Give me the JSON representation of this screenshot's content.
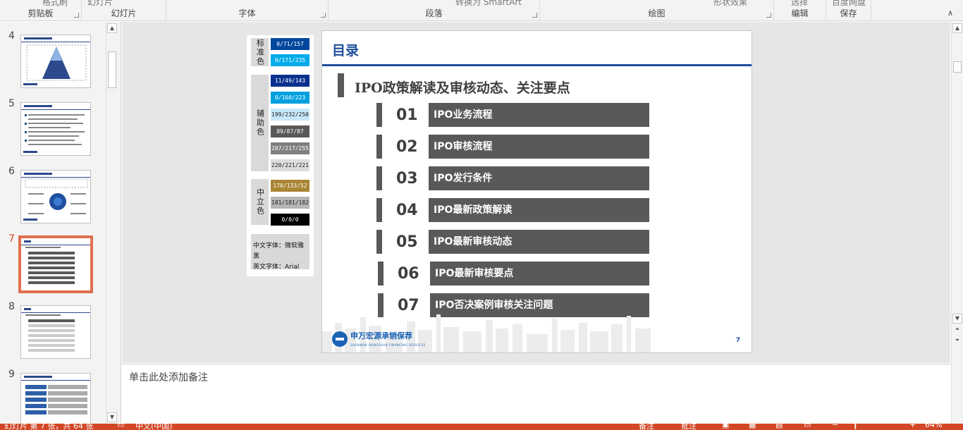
{
  "ribbon": {
    "groups": [
      {
        "label": "剪贴板",
        "top": "格式刷"
      },
      {
        "label": "幻灯片",
        "top": "幻灯片"
      },
      {
        "label": "字体",
        "top": ""
      },
      {
        "label": "段落",
        "top": "转换为 SmartArt"
      },
      {
        "label": "绘图",
        "top": "形状效果"
      },
      {
        "label": "编辑",
        "top": "选择"
      },
      {
        "label": "保存",
        "top": "百度网盘"
      }
    ],
    "collapse_icon": "chevron-up-icon"
  },
  "thumbnails": [
    {
      "number": "4"
    },
    {
      "number": "5"
    },
    {
      "number": "6"
    },
    {
      "number": "7"
    },
    {
      "number": "8"
    },
    {
      "number": "9"
    }
  ],
  "legend": {
    "groups": [
      {
        "label": "标准色",
        "swatches": [
          {
            "text": "0/71/157",
            "bg": "#00479D",
            "fg": "#ffffff"
          },
          {
            "text": "0/171/235",
            "bg": "#00ABEB",
            "fg": "#ffffff"
          }
        ]
      },
      {
        "label": "辅助色",
        "swatches": [
          {
            "text": "11/49/143",
            "bg": "#0B318F",
            "fg": "#ffffff"
          },
          {
            "text": "0/160/223",
            "bg": "#00A0DF",
            "fg": "#ffffff"
          },
          {
            "text": "199/232/250",
            "bg": "#C7E8FA",
            "fg": "#222222"
          },
          {
            "text": "89/87/87",
            "bg": "#595757",
            "fg": "#ffffff"
          },
          {
            "text": "207/217/255",
            "bg": "#7F7F7F",
            "fg": "#ffffff"
          },
          {
            "text": "220/221/221",
            "bg": "#DCDDDD",
            "fg": "#222222"
          }
        ]
      },
      {
        "label": "中立色",
        "swatches": [
          {
            "text": "170/133/52",
            "bg": "#AA8534",
            "fg": "#ffffff"
          },
          {
            "text": "181/181/182",
            "bg": "#B5B5B6",
            "fg": "#222222"
          },
          {
            "text": "0/0/0",
            "bg": "#000000",
            "fg": "#ffffff"
          }
        ]
      }
    ],
    "fonts": {
      "chinese": "中文字体：微软雅黑",
      "english": "英文字体：Arial"
    }
  },
  "slide": {
    "title": "目录",
    "section": "IPO政策解读及审核动态、关注要点",
    "items": [
      {
        "num": "01",
        "text": "IPO业务流程"
      },
      {
        "num": "02",
        "text": "IPO审核流程"
      },
      {
        "num": "03",
        "text": "IPO发行条件"
      },
      {
        "num": "04",
        "text": "IPO最新政策解读"
      },
      {
        "num": "05",
        "text": "IPO最新审核动态"
      },
      {
        "num": "06",
        "text": "IPO最新审核要点"
      },
      {
        "num": "07",
        "text": "IPO否决案例审核关注问题"
      }
    ],
    "logo_cn": "申万宏源承销保荐",
    "logo_en": "SHENWAN HONGYUAN FINANCING SERVICES",
    "page_number": "7",
    "accent": "#1F4E9C",
    "item_bg": "#595959"
  },
  "notes": {
    "placeholder": "单击此处添加备注"
  },
  "status": {
    "slide_info": "幻灯片 第 7 张，共 64 张",
    "language": "中文(中国)",
    "notes_button": "备注",
    "comments_button": "批注",
    "zoom": "64%",
    "bar_color": "#D24726"
  }
}
